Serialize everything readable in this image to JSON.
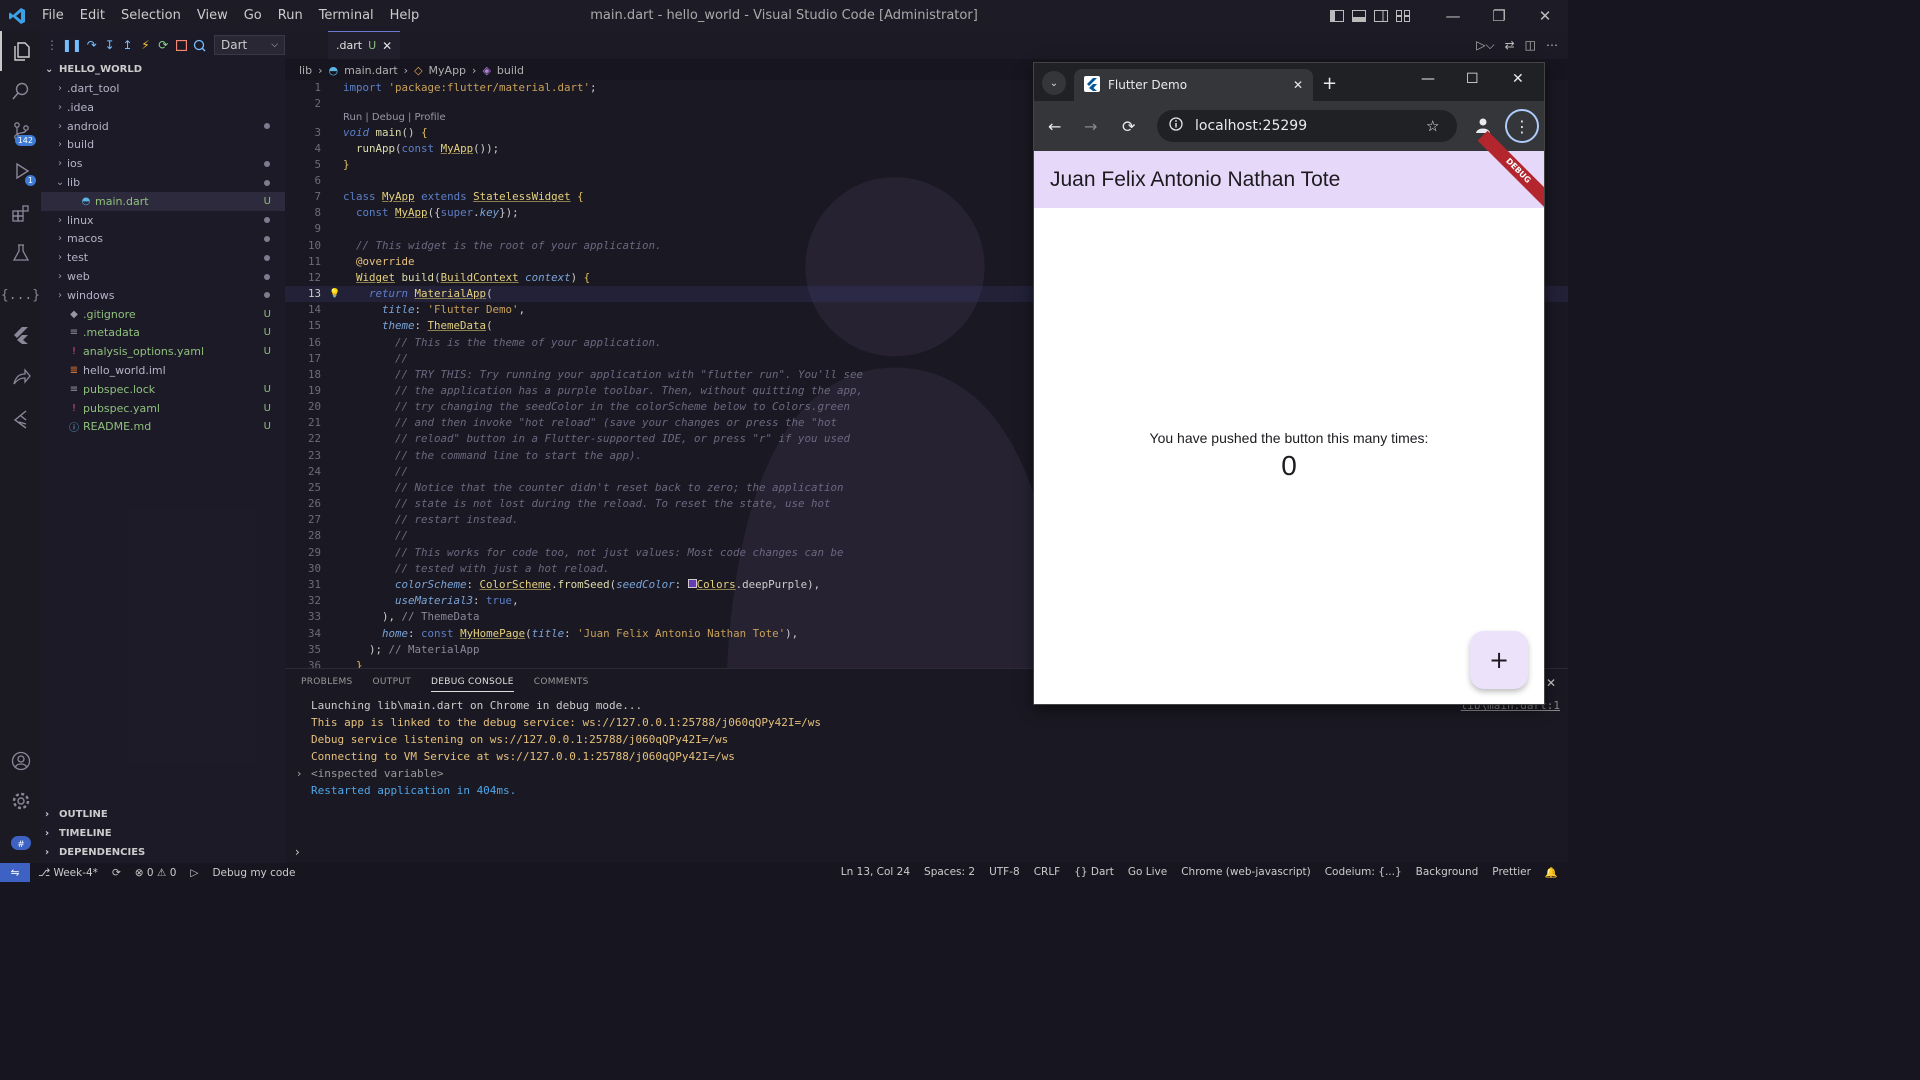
{
  "window": {
    "title": "main.dart - hello_world - Visual Studio Code [Administrator]",
    "menu": [
      "File",
      "Edit",
      "Selection",
      "View",
      "Go",
      "Run",
      "Terminal",
      "Help"
    ]
  },
  "activity_bar": {
    "source_control_badge": "142",
    "run_debug_badge": "1"
  },
  "debug_toolbar": {
    "config": "Dart"
  },
  "explorer": {
    "project": "HELLO_WORLD",
    "items": [
      {
        "label": ".dart_tool",
        "kind": "folder",
        "status": ""
      },
      {
        "label": ".idea",
        "kind": "folder",
        "status": ""
      },
      {
        "label": "android",
        "kind": "folder",
        "status": "dot"
      },
      {
        "label": "build",
        "kind": "folder",
        "status": ""
      },
      {
        "label": "ios",
        "kind": "folder",
        "status": "dot"
      },
      {
        "label": "lib",
        "kind": "folder-open",
        "status": "dot"
      },
      {
        "label": "main.dart",
        "kind": "dart",
        "status": "U"
      },
      {
        "label": "linux",
        "kind": "folder",
        "status": "dot"
      },
      {
        "label": "macos",
        "kind": "folder",
        "status": "dot"
      },
      {
        "label": "test",
        "kind": "folder",
        "status": "dot"
      },
      {
        "label": "web",
        "kind": "folder",
        "status": "dot"
      },
      {
        "label": "windows",
        "kind": "folder",
        "status": "dot"
      },
      {
        "label": ".gitignore",
        "kind": "git",
        "status": "U"
      },
      {
        "label": ".metadata",
        "kind": "file",
        "status": "U"
      },
      {
        "label": "analysis_options.yaml",
        "kind": "yaml",
        "status": "U"
      },
      {
        "label": "hello_world.iml",
        "kind": "xml",
        "status": ""
      },
      {
        "label": "pubspec.lock",
        "kind": "file",
        "status": "U"
      },
      {
        "label": "pubspec.yaml",
        "kind": "yaml",
        "status": "U"
      },
      {
        "label": "README.md",
        "kind": "info",
        "status": "U"
      }
    ],
    "outline": "OUTLINE",
    "timeline": "TIMELINE",
    "dependencies": "DEPENDENCIES"
  },
  "editor": {
    "tab_label": ".dart",
    "tab_status": "U",
    "breadcrumb": [
      "lib",
      "main.dart",
      "MyApp",
      "build"
    ],
    "codelens": "Run | Debug | Profile",
    "line_numbers": [
      "1",
      "2",
      "3",
      "4",
      "5",
      "6",
      "7",
      "8",
      "9",
      "10",
      "11",
      "12",
      "13",
      "14",
      "15",
      "16",
      "17",
      "18",
      "19",
      "20",
      "21",
      "22",
      "23",
      "24",
      "25",
      "26",
      "27",
      "28",
      "29",
      "30",
      "31",
      "32",
      "33",
      "34",
      "35",
      "36"
    ]
  },
  "panel": {
    "tabs": [
      "PROBLEMS",
      "OUTPUT",
      "DEBUG CONSOLE",
      "COMMENTS"
    ],
    "active_tab": "DEBUG CONSOLE",
    "console": [
      {
        "text": "Launching lib\\main.dart on Chrome in debug mode...",
        "color": "#cccccc"
      },
      {
        "text": "This app is linked to the debug service: ws://127.0.0.1:25788/j060qQPy42I=/ws",
        "color": "#e5c07b"
      },
      {
        "text": "Debug service listening on ws://127.0.0.1:25788/j060qQPy42I=/ws",
        "color": "#e5c07b"
      },
      {
        "text": "Connecting to VM Service at ws://127.0.0.1:25788/j060qQPy42I=/ws",
        "color": "#e5c07b"
      },
      {
        "text": "<inspected variable>",
        "color": "#999999"
      },
      {
        "text": "Restarted application in 404ms.",
        "color": "#4fa6e8"
      }
    ],
    "source_link": "lib\\main.dart:1"
  },
  "status_bar": {
    "branch": "Week-4*",
    "errors": "0",
    "warnings": "0",
    "debug_label": "Debug my code",
    "right": [
      "Ln 13, Col 24",
      "Spaces: 2",
      "UTF-8",
      "CRLF",
      "{} Dart",
      "Go Live",
      "Chrome (web-javascript)",
      "Codeium: {...}",
      "Background",
      "Prettier"
    ]
  },
  "browser": {
    "tab_title": "Flutter Demo",
    "url": "localhost:25299",
    "app_title": "Juan Felix Antonio Nathan Tote",
    "debug_banner": "DEBUG",
    "counter_message": "You have pushed the button this many times:",
    "counter_value": "0",
    "fab_label": "+"
  },
  "colors": {
    "app_bar": "#e6d8f8",
    "debug_ribbon": "#b3262e",
    "accent": "#3d62c4"
  }
}
